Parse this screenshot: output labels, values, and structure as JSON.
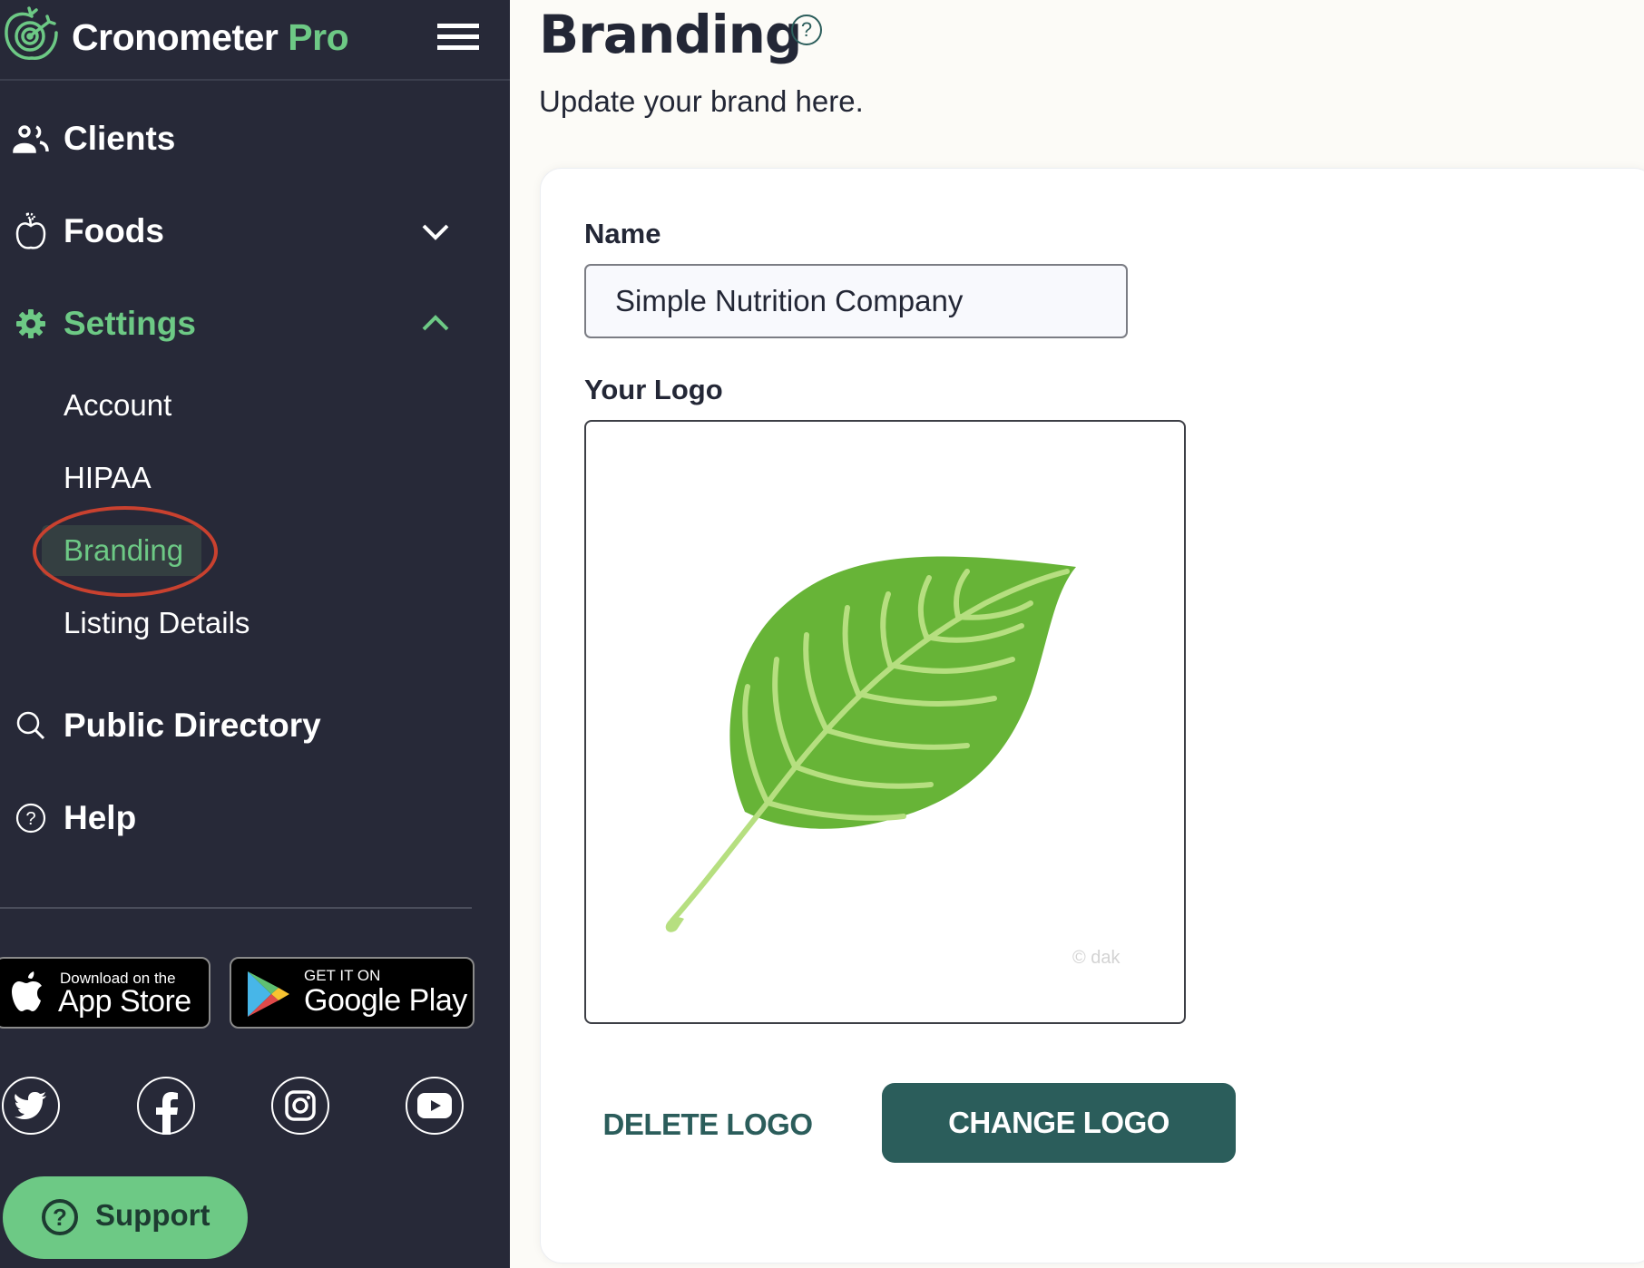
{
  "app": {
    "brand_name": "Cronometer",
    "brand_suffix": "Pro",
    "colors": {
      "sidebar_bg": "#272938",
      "accent_green": "#6dc985",
      "primary_teal": "#2b5d5b",
      "annotation_red": "#c9412f",
      "page_bg": "#fcfbf7"
    }
  },
  "sidebar": {
    "menu_icon": "hamburger-icon",
    "nav": [
      {
        "label": "Clients",
        "icon": "users-icon"
      },
      {
        "label": "Foods",
        "icon": "apple-icon",
        "chevron": "chevron-down-icon"
      },
      {
        "label": "Settings",
        "icon": "gear-icon",
        "chevron": "chevron-up-icon",
        "active": true
      },
      {
        "label": "Public Directory",
        "icon": "search-icon"
      },
      {
        "label": "Help",
        "icon": "help-circle-icon"
      }
    ],
    "settings_sub": [
      {
        "label": "Account"
      },
      {
        "label": "HIPAA"
      },
      {
        "label": "Branding",
        "active": true
      },
      {
        "label": "Listing Details"
      }
    ],
    "app_store": {
      "small": "Download on the",
      "big": "App Store"
    },
    "google_play": {
      "small": "GET IT ON",
      "big": "Google Play"
    },
    "social": [
      "twitter-icon",
      "facebook-icon",
      "instagram-icon",
      "youtube-icon"
    ],
    "support_label": "Support"
  },
  "main": {
    "title": "Branding",
    "subtitle": "Update your brand here.",
    "form": {
      "name_label": "Name",
      "name_value": "Simple Nutrition Company",
      "logo_label": "Your Logo",
      "logo_watermark": "© dak",
      "delete_label": "DELETE LOGO",
      "change_label": "CHANGE LOGO"
    }
  }
}
